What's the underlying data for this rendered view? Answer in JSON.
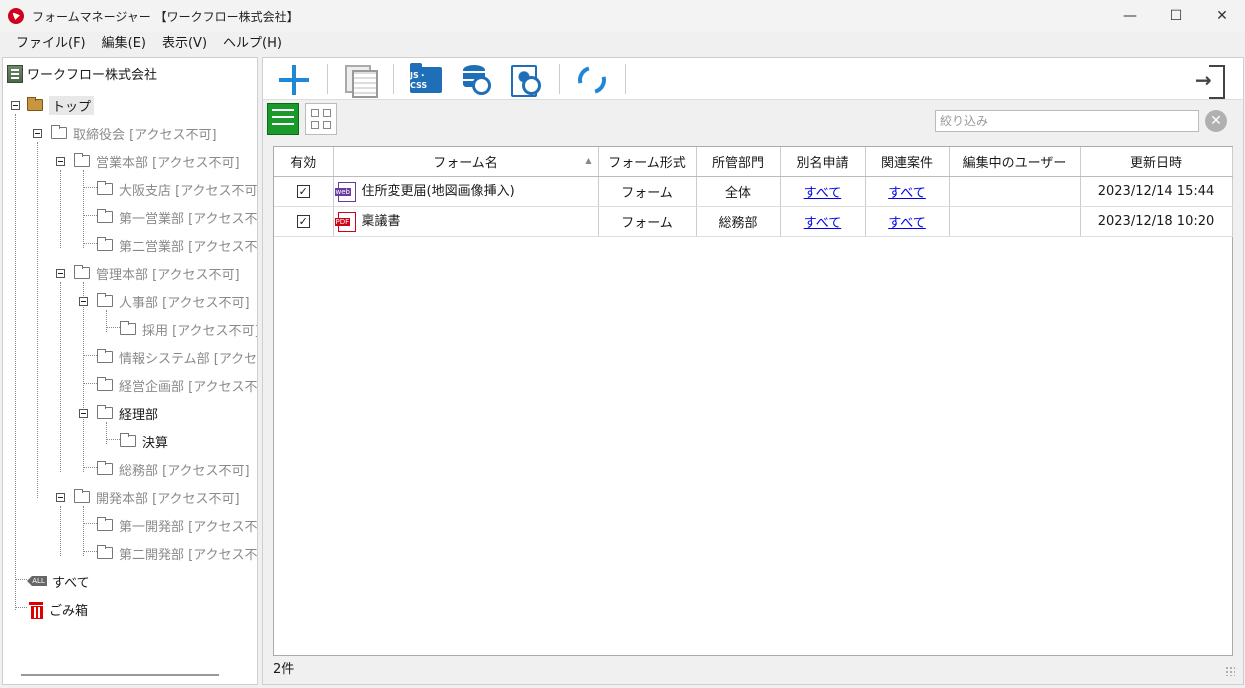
{
  "window": {
    "title": "フォームマネージャー 【ワークフロー株式会社】"
  },
  "menu": [
    {
      "label": "ファイル(F)"
    },
    {
      "label": "編集(E)"
    },
    {
      "label": "表示(V)"
    },
    {
      "label": "ヘルプ(H)"
    }
  ],
  "tree": {
    "root_label": "ワークフロー株式会社",
    "top_label": "トップ",
    "nodes": [
      {
        "label": "取締役会 [アクセス不可]"
      },
      {
        "label": "営業本部 [アクセス不可]"
      },
      {
        "label": "大阪支店 [アクセス不可]"
      },
      {
        "label": "第一営業部 [アクセス不可"
      },
      {
        "label": "第二営業部 [アクセス不可"
      },
      {
        "label": "管理本部 [アクセス不可]"
      },
      {
        "label": "人事部 [アクセス不可]"
      },
      {
        "label": "採用 [アクセス不可]"
      },
      {
        "label": "情報システム部 [アクセス不"
      },
      {
        "label": "経営企画部 [アクセス不可"
      },
      {
        "label": "経理部"
      },
      {
        "label": "決算"
      },
      {
        "label": "総務部 [アクセス不可]"
      },
      {
        "label": "開発本部 [アクセス不可]"
      },
      {
        "label": "第一開発部 [アクセス不可"
      },
      {
        "label": "第二開発部 [アクセス不可"
      }
    ],
    "all_label": "すべて",
    "all_badge": "ALL",
    "trash_label": "ごみ箱"
  },
  "toolbar": {
    "jscss_label": "JS・CSS"
  },
  "filter": {
    "placeholder": "絞り込み"
  },
  "table": {
    "headers": [
      "有効",
      "フォーム名",
      "フォーム形式",
      "所管部門",
      "別名申請",
      "関連案件",
      "編集中のユーザー",
      "更新日時"
    ],
    "rows": [
      {
        "enabled": "✓",
        "icon": "web",
        "name": "住所変更届(地図画像挿入)",
        "format": "フォーム",
        "dept": "全体",
        "alias": "すべて",
        "related": "すべて",
        "editing_user": "",
        "updated": "2023/12/14 15:44"
      },
      {
        "enabled": "✓",
        "icon": "pdf",
        "name": "稟議書",
        "format": "フォーム",
        "dept": "総務部",
        "alias": "すべて",
        "related": "すべて",
        "editing_user": "",
        "updated": "2023/12/18 10:20"
      }
    ]
  },
  "status": {
    "count": "2件"
  }
}
